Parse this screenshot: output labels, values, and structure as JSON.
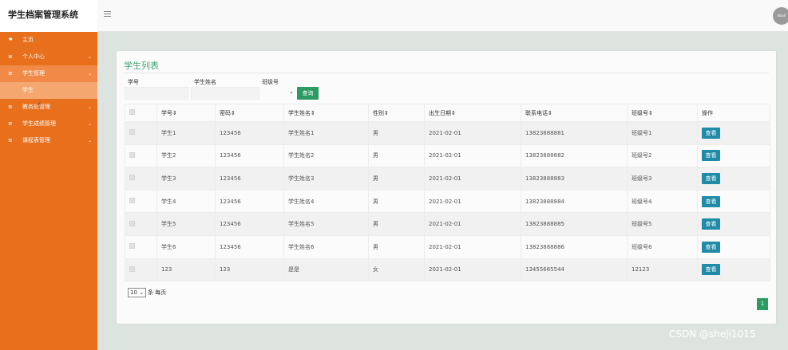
{
  "app": {
    "title": "学生档案管理系统",
    "avatar_text": "Noah"
  },
  "sidebar": {
    "items": [
      {
        "label": "主页",
        "icon": "flag-icon",
        "has_children": false,
        "open": false
      },
      {
        "label": "个人中心",
        "icon": "list-icon",
        "has_children": true,
        "open": false
      },
      {
        "label": "学生管理",
        "icon": "list-icon",
        "has_children": true,
        "open": true
      },
      {
        "label": "教务处管理",
        "icon": "list-icon",
        "has_children": true,
        "open": false
      },
      {
        "label": "学生成绩管理",
        "icon": "list-icon",
        "has_children": true,
        "open": false
      },
      {
        "label": "课程表管理",
        "icon": "list-icon",
        "has_children": true,
        "open": false
      }
    ],
    "subitem": "学生"
  },
  "page": {
    "title": "学生列表"
  },
  "filters": {
    "student_no_label": "学号",
    "student_name_label": "学生姓名",
    "class_no_label": "班级号",
    "search_label": "查询"
  },
  "table": {
    "headers": [
      "学号",
      "密码",
      "学生姓名",
      "性别",
      "出生日期",
      "联系电话",
      "班级号",
      "操作"
    ],
    "rows": [
      [
        "学生1",
        "123456",
        "学生姓名1",
        "男",
        "2021-02-01",
        "13823888881",
        "班级号1"
      ],
      [
        "学生2",
        "123456",
        "学生姓名2",
        "男",
        "2021-02-01",
        "13823888882",
        "班级号2"
      ],
      [
        "学生3",
        "123456",
        "学生姓名3",
        "男",
        "2021-02-01",
        "13823888883",
        "班级号3"
      ],
      [
        "学生4",
        "123456",
        "学生姓名4",
        "男",
        "2021-02-01",
        "13823888884",
        "班级号4"
      ],
      [
        "学生5",
        "123456",
        "学生姓名5",
        "男",
        "2021-02-01",
        "13823888885",
        "班级号5"
      ],
      [
        "学生6",
        "123456",
        "学生姓名6",
        "男",
        "2021-02-01",
        "13823888886",
        "班级号6"
      ],
      [
        "123",
        "123",
        "是是",
        "女",
        "2021-02-01",
        "13455665544",
        "12123"
      ]
    ],
    "view_label": "查看",
    "sort_icon": "sort-icon"
  },
  "pagination": {
    "page_size": "10",
    "page_size_suffix": "条 每页",
    "current_page": "1"
  },
  "watermark": "CSDN @sheji1015",
  "colors": {
    "sidebar": "#e86f1c",
    "accent_green": "#2b9a63",
    "view_button": "#1f8ba7",
    "title_green": "#43a271"
  }
}
